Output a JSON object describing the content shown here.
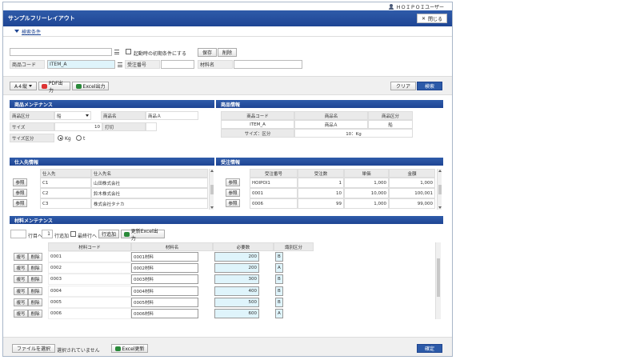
{
  "header": {
    "user_name": "ＨＯＩＰＯＩユーザー",
    "title": "サンプルフリーレイアウト",
    "close_label": "閉じる"
  },
  "condition": {
    "toggle_label": "検索条件",
    "startup_label": "起動時の初期条件にする",
    "save_label": "保存",
    "delete_label": "削除",
    "product_code_label": "商品コード",
    "product_code_value": "ITEM_A",
    "order_no_label": "受注番号",
    "order_no_value": "",
    "material_name_label": "材料名",
    "material_name_value": "",
    "keyword_value": ""
  },
  "toolbar": {
    "paper_select": "A４縦",
    "pdf_label": "PDF出力",
    "excel_label": "Excel出力",
    "clear_label": "クリア",
    "search_label": "検索"
  },
  "product_maint": {
    "title": "商品メンテナンス",
    "kind_label": "商品区分",
    "kind_value": "船",
    "name_label": "商品名",
    "name_value": "商品Ａ",
    "size_label": "サイズ",
    "size_value": "10",
    "note_label": "打切",
    "size_kind_label": "サイズ区分",
    "radio_kg": "Kg",
    "radio_t": "t",
    "radio_selected": "Kg"
  },
  "product_info": {
    "title": "商品情報",
    "headers": [
      "商品コード",
      "商品名",
      "商品区分"
    ],
    "values": [
      "ITEM_A",
      "商品Ａ",
      "船"
    ],
    "size_label": "サイズ：区分",
    "size_value": "10：Kg"
  },
  "vendor": {
    "title": "仕入先情報",
    "headers": [
      "仕入先",
      "仕入先名"
    ],
    "ref_label": "参照",
    "rows": [
      [
        "C1",
        "山田株式会社"
      ],
      [
        "C2",
        "鈴木株式会社"
      ],
      [
        "C3",
        "株式会社タナカ"
      ]
    ]
  },
  "order": {
    "title": "受注情報",
    "headers": [
      "受注番号",
      "受注数",
      "単価",
      "金額"
    ],
    "ref_label": "参照",
    "rows": [
      [
        "HOIPOI1",
        "1",
        "1,000",
        "1,000"
      ],
      [
        "0001",
        "10",
        "10,000",
        "100,001"
      ],
      [
        "0006",
        "99",
        "1,000",
        "99,000"
      ]
    ]
  },
  "material": {
    "title": "材料メンテナンス",
    "row_to_value": "",
    "row_to_label": "行目へ",
    "add_count_value": "1",
    "add_label": "行追加",
    "last_row_label": "最終行へ",
    "row_add_button": "行追加",
    "update_excel": "更新Excel出力",
    "headers": [
      "材料コード",
      "材料名",
      "必要数",
      "識別区分"
    ],
    "copy_label": "複写",
    "delete_label": "削除",
    "rows": [
      [
        "0001",
        "0001材料",
        "200",
        "B"
      ],
      [
        "0002",
        "0002材料",
        "200",
        "A"
      ],
      [
        "0003",
        "0003材料",
        "300",
        "B"
      ],
      [
        "0004",
        "0004材料",
        "400",
        "B"
      ],
      [
        "0005",
        "0005材料",
        "500",
        "B"
      ],
      [
        "0006",
        "0006材料",
        "600",
        "A"
      ]
    ]
  },
  "footer": {
    "file_button": "ファイルを選択",
    "file_status": "選択されていません",
    "excel_update": "Excel更新",
    "confirm_label": "確定"
  }
}
